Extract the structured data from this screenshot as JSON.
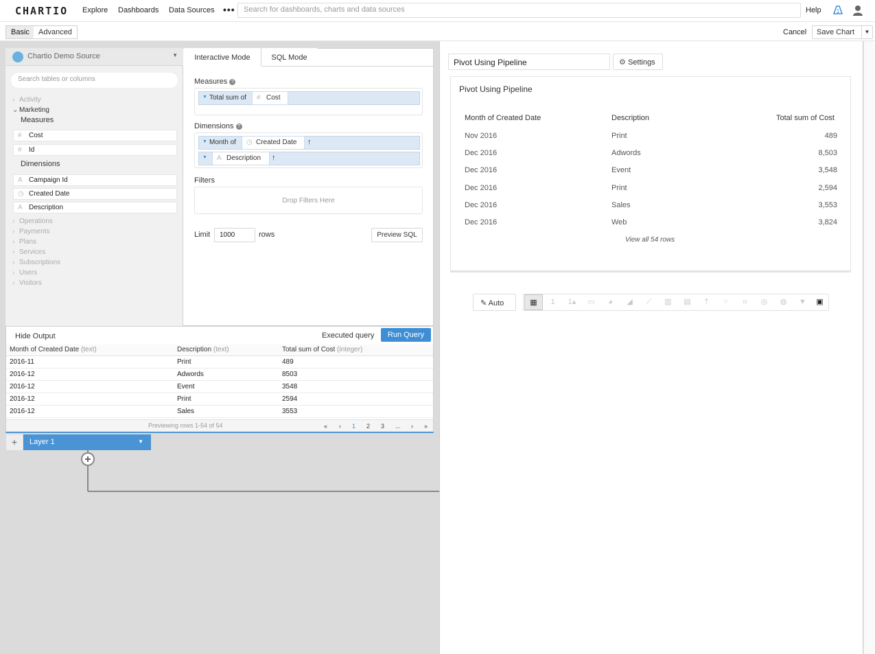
{
  "nav": {
    "logo": "CHARTIO",
    "explore": "Explore",
    "dashboards": "Dashboards",
    "data_sources": "Data Sources",
    "more": "•••",
    "search_placeholder": "Search for dashboards, charts and data sources",
    "help": "Help"
  },
  "toolbar": {
    "basic": "Basic",
    "advanced": "Advanced",
    "cancel": "Cancel",
    "save_chart": "Save Chart"
  },
  "source": {
    "name": "Chartio Demo Source",
    "search_placeholder": "Search tables or columns",
    "tables_top": [
      "Activity"
    ],
    "open_table": "Marketing",
    "measures_label": "Measures",
    "measures": [
      "Cost",
      "Id"
    ],
    "dimensions_label": "Dimensions",
    "dimensions": [
      "Campaign Id",
      "Created Date",
      "Description"
    ],
    "tables_bottom": [
      "Operations",
      "Payments",
      "Plans",
      "Services",
      "Subscriptions",
      "Users",
      "Visitors"
    ]
  },
  "query": {
    "tab_interactive": "Interactive Mode",
    "tab_sql": "SQL Mode",
    "measures_label": "Measures",
    "measure_agg": "Total sum of",
    "measure_field": "Cost",
    "dimensions_label": "Dimensions",
    "dim1_agg": "Month of",
    "dim1_field": "Created Date",
    "dim2_field": "Description",
    "filters_label": "Filters",
    "filters_placeholder": "Drop Filters Here",
    "limit_label": "Limit",
    "limit_value": "1000",
    "rows_label": "rows",
    "preview_sql": "Preview SQL"
  },
  "output": {
    "hide": "Hide Output",
    "executed": "Executed query",
    "run": "Run Query",
    "columns": [
      {
        "name": "Month of Created Date",
        "type": "(text)"
      },
      {
        "name": "Description",
        "type": "(text)"
      },
      {
        "name": "Total sum of Cost",
        "type": "(integer)"
      }
    ],
    "rows": [
      [
        "2016-11",
        "Print",
        "489"
      ],
      [
        "2016-12",
        "Adwords",
        "8503"
      ],
      [
        "2016-12",
        "Event",
        "3548"
      ],
      [
        "2016-12",
        "Print",
        "2594"
      ],
      [
        "2016-12",
        "Sales",
        "3553"
      ]
    ],
    "preview_text": "Previewing rows 1-54 of 54",
    "pager": [
      "«",
      "‹",
      "1",
      "2",
      "3",
      "...",
      "›",
      "»"
    ]
  },
  "layer": {
    "plus": "+",
    "name": "Layer 1"
  },
  "chart": {
    "title_input": "Pivot Using Pipeline",
    "settings": "Settings",
    "preview_title": "Pivot Using Pipeline",
    "headers": [
      "Month of Created Date",
      "Description",
      "Total sum of Cost"
    ],
    "rows": [
      [
        "Nov 2016",
        "Print",
        "489"
      ],
      [
        "Dec 2016",
        "Adwords",
        "8,503"
      ],
      [
        "Dec 2016",
        "Event",
        "3,548"
      ],
      [
        "Dec 2016",
        "Print",
        "2,594"
      ],
      [
        "Dec 2016",
        "Sales",
        "3,553"
      ],
      [
        "Dec 2016",
        "Web",
        "3,824"
      ]
    ],
    "view_all": "View all 54 rows",
    "auto": "Auto",
    "chart_types": [
      "table-icon",
      "single-value-icon",
      "trend-value-icon",
      "progress-bar-icon",
      "pie-icon",
      "area-icon",
      "line-icon",
      "bar-icon",
      "bar-line-icon",
      "funnel-bar-icon",
      "scatter-icon",
      "bubble-icon",
      "geo-icon",
      "world-map-icon",
      "funnel-icon",
      "pivot-table-icon"
    ]
  },
  "colors": {
    "accent": "#3d8ed4",
    "chip_bg": "#dce9f5"
  }
}
